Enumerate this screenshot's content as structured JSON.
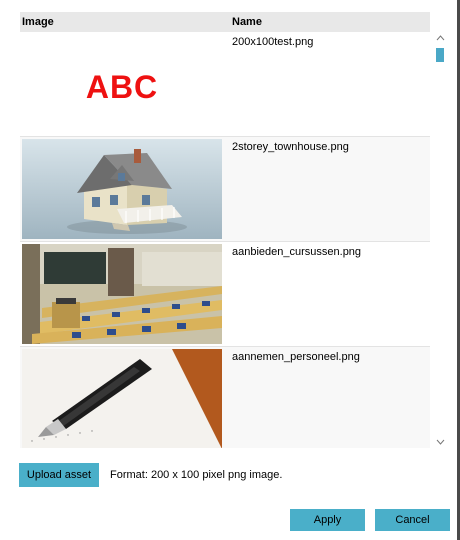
{
  "table": {
    "headers": {
      "image": "Image",
      "name": "Name"
    },
    "rows": [
      {
        "name": "200x100test.png",
        "thumb_text": "ABC"
      },
      {
        "name": "2storey_townhouse.png"
      },
      {
        "name": "aanbieden_cursussen.png"
      },
      {
        "name": "aannemen_personeel.png"
      }
    ]
  },
  "scrollbar": {
    "up_icon": "chevron-up",
    "down_icon": "chevron-down",
    "accent": "#4aa8c7"
  },
  "upload": {
    "label": "Upload asset"
  },
  "format_hint": "Format: 200 x 100 pixel png image.",
  "footer": {
    "apply_label": "Apply",
    "cancel_label": "Cancel"
  },
  "colors": {
    "button": "#4aafc9",
    "abc_text": "#ee1111"
  }
}
